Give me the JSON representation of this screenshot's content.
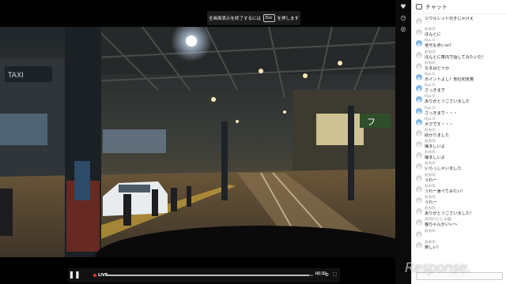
{
  "player": {
    "fullscreen_notice_prefix": "全画面表示を終了するには",
    "fullscreen_notice_key": "Esc",
    "fullscreen_notice_suffix": "を押します",
    "live_label": "LIVE",
    "progress": 0.98,
    "time_badge": "HD 3D",
    "scene_sign_taxi": "TAXI",
    "scene_sign_shop": "フ"
  },
  "icons": {
    "play": "pause-icon",
    "heart": "heart-icon",
    "clock": "clock-icon",
    "share": "share-icon",
    "settings": "gear-icon",
    "fullscreen": "fullscreen-icon"
  },
  "chat": {
    "title": "チャット",
    "messages": [
      {
        "name": "",
        "text": "ジウルレッドのきじゃけえ",
        "avatar": "gray"
      },
      {
        "name": "おおの",
        "text": "ほんとに",
        "avatar": "gray"
      },
      {
        "name": "Ryu 0",
        "text": "信号も赤いｗ？",
        "avatar": "blue"
      },
      {
        "name": "おおの",
        "text": "ほんとに車内で話してみたいだ！",
        "avatar": "gray"
      },
      {
        "name": "おおの",
        "text": "なまはどうか",
        "avatar": "gray"
      },
      {
        "name": "Ryu 0",
        "text": "ポイントよし！他社初見着",
        "avatar": "blue"
      },
      {
        "name": "Ryu 0",
        "text": "さっきまで",
        "avatar": "blue"
      },
      {
        "name": "Ryu 0",
        "text": "ありがとうございました",
        "avatar": "blue"
      },
      {
        "name": "Ryu 0",
        "text": "さっきまで・・・",
        "avatar": "blue"
      },
      {
        "name": "Ryu 0",
        "text": "ボクです・・・",
        "avatar": "blue"
      },
      {
        "name": "おおの",
        "text": "助かりました",
        "avatar": "gray"
      },
      {
        "name": "おおの",
        "text": "撮ましいよ",
        "avatar": "gray"
      },
      {
        "name": "おおの",
        "text": "撮ましいよ",
        "avatar": "gray"
      },
      {
        "name": "おおの",
        "text": "いらっしゃいました",
        "avatar": "gray"
      },
      {
        "name": "おおの",
        "text": "うれー",
        "avatar": "gray"
      },
      {
        "name": "おおの",
        "text": "うれー食べてみたい！",
        "avatar": "gray"
      },
      {
        "name": "おおの",
        "text": "うれー",
        "avatar": "gray"
      },
      {
        "name": "おおの",
        "text": "ありがとうございました！",
        "avatar": "gray"
      },
      {
        "name": "日刊わらら 山猫",
        "text": "猫ちゃんかいい～",
        "avatar": "gray"
      },
      {
        "name": "おおの",
        "text": "",
        "avatar": "gray"
      },
      {
        "name": "おおの",
        "text": "楽しい！",
        "avatar": "gray"
      }
    ]
  },
  "watermark": "Response."
}
